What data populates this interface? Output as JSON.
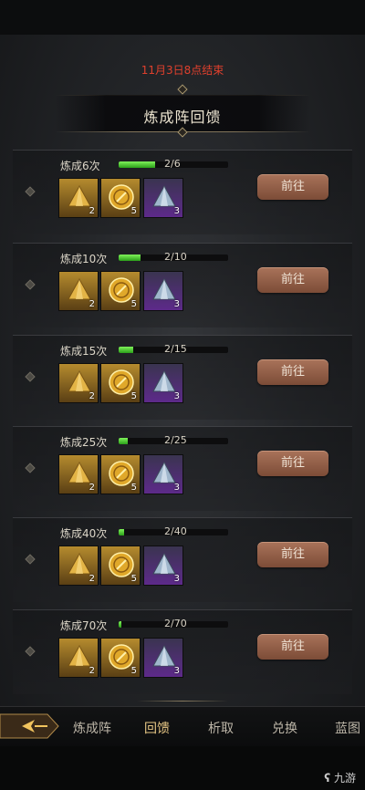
{
  "event": {
    "deadline": "11月3日8点结束",
    "title": "炼成阵回馈"
  },
  "rewards": [
    {
      "label": "炼成6次",
      "progress_text": "2/6",
      "progress": 0.333,
      "button": "前往",
      "items": [
        {
          "icon": "gold-crystal-icon",
          "count": "2"
        },
        {
          "icon": "gold-orb-icon",
          "count": "5"
        },
        {
          "icon": "blue-crystal-icon",
          "count": "3"
        }
      ]
    },
    {
      "label": "炼成10次",
      "progress_text": "2/10",
      "progress": 0.2,
      "button": "前往",
      "items": [
        {
          "icon": "gold-crystal-icon",
          "count": "2"
        },
        {
          "icon": "gold-orb-icon",
          "count": "5"
        },
        {
          "icon": "blue-crystal-icon",
          "count": "3"
        }
      ]
    },
    {
      "label": "炼成15次",
      "progress_text": "2/15",
      "progress": 0.133,
      "button": "前往",
      "items": [
        {
          "icon": "gold-crystal-icon",
          "count": "2"
        },
        {
          "icon": "gold-orb-icon",
          "count": "5"
        },
        {
          "icon": "blue-crystal-icon",
          "count": "3"
        }
      ]
    },
    {
      "label": "炼成25次",
      "progress_text": "2/25",
      "progress": 0.08,
      "button": "前往",
      "items": [
        {
          "icon": "gold-crystal-icon",
          "count": "2"
        },
        {
          "icon": "gold-orb-icon",
          "count": "5"
        },
        {
          "icon": "blue-crystal-icon",
          "count": "3"
        }
      ]
    },
    {
      "label": "炼成40次",
      "progress_text": "2/40",
      "progress": 0.05,
      "button": "前往",
      "items": [
        {
          "icon": "gold-crystal-icon",
          "count": "2"
        },
        {
          "icon": "gold-orb-icon",
          "count": "5"
        },
        {
          "icon": "blue-crystal-icon",
          "count": "3"
        }
      ]
    },
    {
      "label": "炼成70次",
      "progress_text": "2/70",
      "progress": 0.029,
      "button": "前往",
      "items": [
        {
          "icon": "gold-crystal-icon",
          "count": "2"
        },
        {
          "icon": "gold-orb-icon",
          "count": "5"
        },
        {
          "icon": "blue-crystal-icon",
          "count": "3"
        }
      ]
    }
  ],
  "tabs": [
    {
      "label": "炼成阵",
      "active": false
    },
    {
      "label": "回馈",
      "active": true
    },
    {
      "label": "析取",
      "active": false
    },
    {
      "label": "兑换",
      "active": false
    },
    {
      "label": "蓝图",
      "active": false
    }
  ],
  "watermark": "九游",
  "colors": {
    "deadline": "#e0402d",
    "progress_fill": "#4fd12f",
    "button": "#93614a",
    "tab_active": "#e7c785",
    "item_gold_bg": "#8a6420",
    "item_purple_bg": "#5d2a8a"
  }
}
